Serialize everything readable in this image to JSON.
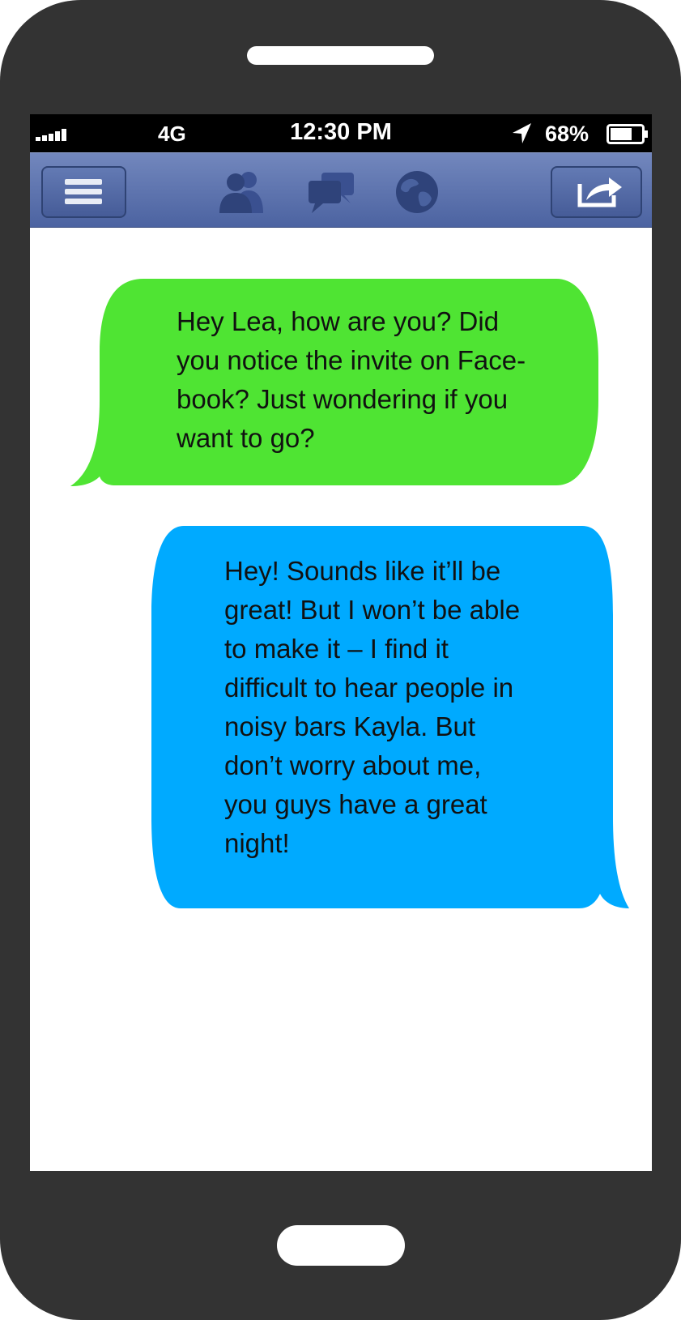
{
  "status_bar": {
    "network": "4G",
    "time": "12:30 PM",
    "battery": "68%",
    "battery_level": 0.68,
    "signal_bars": 5
  },
  "navbar": {
    "icons": [
      "menu-icon",
      "friends-icon",
      "messages-icon",
      "globe-icon",
      "share-icon"
    ],
    "background": "#5b70ad"
  },
  "conversation": {
    "messages": [
      {
        "side": "left",
        "color": "#4fe433",
        "text": "Hey Lea, how are you? Did\nyou notice the invite on Face-\nbook? Just wondering if you\nwant to go?"
      },
      {
        "side": "right",
        "color": "#00aaff",
        "text": "Hey! Sounds like it’ll be\ngreat! But I won’t be able\nto make it – I find it\ndifficult to hear people in\nnoisy bars Kayla. But\ndon’t worry about me,\nyou guys have a great\nnight!"
      }
    ]
  }
}
